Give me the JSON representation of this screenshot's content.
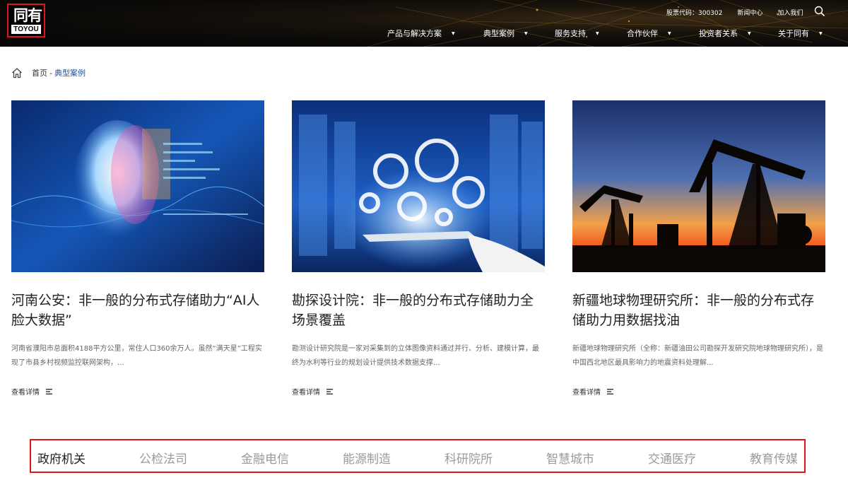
{
  "header": {
    "logo_cn": "同有",
    "logo_en": "TOYOU",
    "top_links": [
      "股票代码：300302",
      "新闻中心",
      "加入我们"
    ],
    "nav": [
      "产品与解决方案",
      "典型案例",
      "服务支持",
      "合作伙伴",
      "投资者关系",
      "关于同有"
    ],
    "accent_color": "#e0141e"
  },
  "breadcrumb": {
    "home": "首页",
    "separator": "-",
    "current": "典型案例"
  },
  "cards": [
    {
      "image": "ai-face-image",
      "title": "河南公安：非一般的分布式存储助力“AI人脸大数据”",
      "desc": "河南省濮阳市总面积4188平方公里，常住人口360余万人。虽然“满天星”工程实现了市县乡村视频监控联网架构，...",
      "more": "查看详情"
    },
    {
      "image": "gears-tablet-image",
      "title": "勘探设计院：非一般的分布式存储助力全场景覆盖",
      "desc": "勘测设计研究院是一家对采集到的立体图像资料通过并行、分析、建模计算，最终为水利等行业的规划设计提供技术数据支撑...",
      "more": "查看详情"
    },
    {
      "image": "oil-pump-sunset-image",
      "title": "新疆地球物理研究所：非一般的分布式存储助力用数据找油",
      "desc": "新疆地球物理研究所（全称：新疆油田公司勘探开发研究院地球物理研究所），是中国西北地区最具影响力的地震资料处理解...",
      "more": "查看详情"
    }
  ],
  "categories": [
    "政府机关",
    "公检法司",
    "金融电信",
    "能源制造",
    "科研院所",
    "智慧城市",
    "交通医疗",
    "教育传媒"
  ],
  "active_category": "政府机关"
}
